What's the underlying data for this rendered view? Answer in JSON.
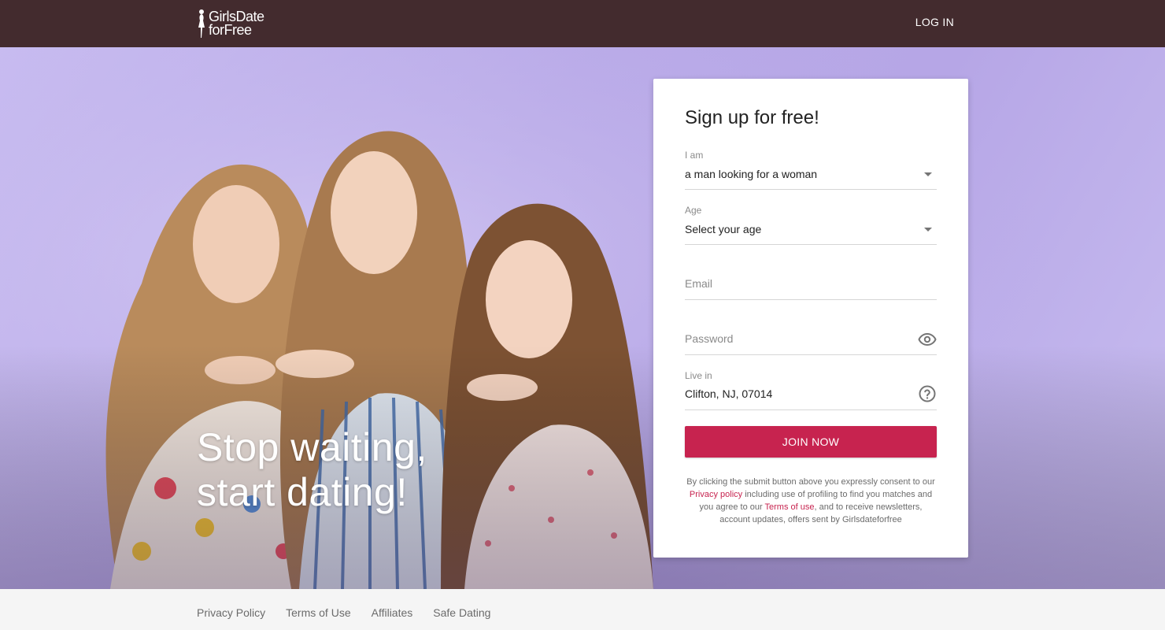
{
  "header": {
    "logo_line1": "GirlsDate",
    "logo_line2": "forFree",
    "login_label": "LOG IN"
  },
  "hero": {
    "headline_line1": "Stop waiting,",
    "headline_line2": "start dating!"
  },
  "signup": {
    "title": "Sign up for free!",
    "iam": {
      "label": "I am",
      "value": "a man looking for a woman"
    },
    "age": {
      "label": "Age",
      "value": "Select your age"
    },
    "email": {
      "placeholder": "Email"
    },
    "password": {
      "placeholder": "Password"
    },
    "location": {
      "label": "Live in",
      "value": "Clifton, NJ, 07014"
    },
    "join_label": "JOIN NOW",
    "legal": {
      "part1": "By clicking the submit button above you expressly consent to our ",
      "privacy_link": "Privacy policy",
      "part2": " including use of profiling to find you matches and you agree to our ",
      "terms_link": "Terms of use",
      "part3": ", and to receive newsletters, account updates, offers sent by Girlsdateforfree"
    }
  },
  "footer": {
    "links": [
      "Privacy Policy",
      "Terms of Use",
      "Affiliates",
      "Safe Dating"
    ]
  },
  "colors": {
    "topbar": "#432b2e",
    "accent": "#c7234f",
    "hero_background": "#b9aae8"
  },
  "icons": [
    "woman-silhouette-icon",
    "dropdown-caret-icon",
    "eye-icon",
    "help-circle-icon"
  ]
}
